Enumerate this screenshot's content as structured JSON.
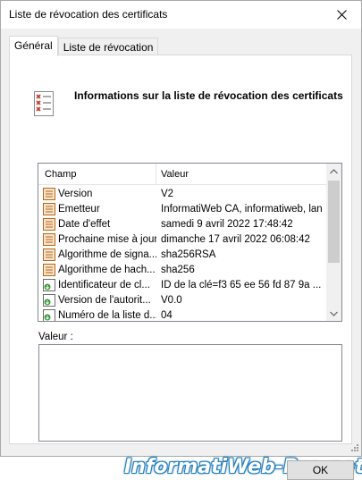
{
  "window": {
    "title": "Liste de révocation des certificats"
  },
  "tabs": [
    {
      "label": "Général"
    },
    {
      "label": "Liste de révocation"
    }
  ],
  "header": {
    "title": "Informations sur la liste de révocation des certificats",
    "icon": "certificate-revocation-list-icon"
  },
  "details": {
    "columns": {
      "field": "Champ",
      "value": "Valeur"
    },
    "rows": [
      {
        "field": "Version",
        "value": "V2",
        "icon": "field-doc-icon"
      },
      {
        "field": "Émetteur",
        "value": "InformatiWeb CA, informatiweb, lan",
        "icon": "field-doc-icon"
      },
      {
        "field": "Date d'effet",
        "value": "samedi 9 avril 2022 17:48:42",
        "icon": "field-doc-icon"
      },
      {
        "field": "Prochaine mise à jour",
        "value": "dimanche 17 avril 2022 06:08:42",
        "icon": "field-doc-icon"
      },
      {
        "field": "Algorithme de signa...",
        "value": "sha256RSA",
        "icon": "field-doc-icon"
      },
      {
        "field": "Algorithme de hach...",
        "value": "sha256",
        "icon": "field-doc-icon"
      },
      {
        "field": "Identificateur de cl...",
        "value": "ID de la clé=f3 65 ee 56 fd 87 9a ...",
        "icon": "extension-icon"
      },
      {
        "field": "Version de l'autorit...",
        "value": "V0.0",
        "icon": "extension-icon"
      },
      {
        "field": "Numéro de la liste d...",
        "value": "04",
        "icon": "extension-icon"
      }
    ]
  },
  "value_panel": {
    "label": "Valeur :",
    "content": ""
  },
  "ok_label": "OK",
  "watermark": "InformatiWeb-Pro.net"
}
